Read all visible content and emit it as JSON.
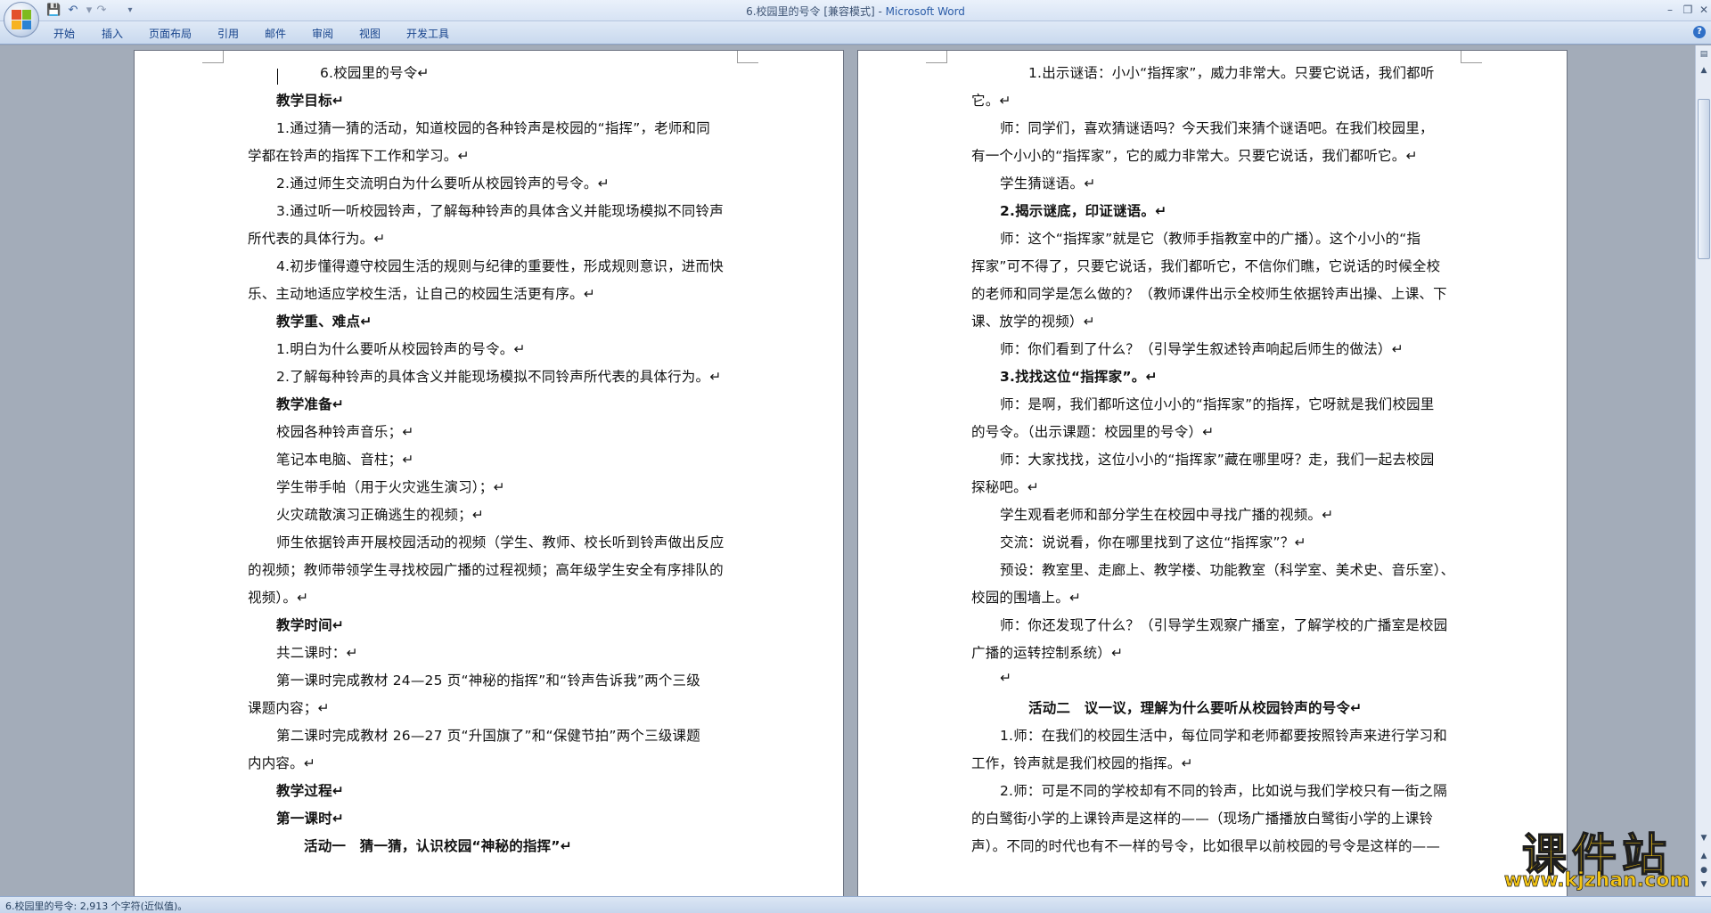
{
  "window": {
    "title": "6.校园里的号令 [兼容模式] - ",
    "app_name": "Microsoft Word"
  },
  "quick_access": {
    "save_icon": "save-icon",
    "undo_icon": "undo-icon",
    "redo_icon": "redo-icon"
  },
  "ribbon": {
    "tabs": [
      "开始",
      "插入",
      "页面布局",
      "引用",
      "邮件",
      "审阅",
      "视图",
      "开发工具"
    ]
  },
  "document": {
    "left_page": [
      {
        "text": "6.校园里的号令↵",
        "bold": false
      },
      {
        "text": "教学目标↵",
        "bold": true
      },
      {
        "text": "1.通过猜一猜的活动，知道校园的各种铃声是校园的“指挥”，老师和同",
        "bold": false
      },
      {
        "text": "学都在铃声的指挥下工作和学习。↵",
        "bold": false
      },
      {
        "text": "2.通过师生交流明白为什么要听从校园铃声的号令。↵",
        "bold": false
      },
      {
        "text": "3.通过听一听校园铃声，了解每种铃声的具体含义并能现场模拟不同铃声",
        "bold": false
      },
      {
        "text": "所代表的具体行为。↵",
        "bold": false
      },
      {
        "text": "4.初步懂得遵守校园生活的规则与纪律的重要性，形成规则意识，进而快",
        "bold": false
      },
      {
        "text": "乐、主动地适应学校生活，让自己的校园生活更有序。↵",
        "bold": false
      },
      {
        "text": "教学重、难点↵",
        "bold": true
      },
      {
        "text": "1.明白为什么要听从校园铃声的号令。↵",
        "bold": false
      },
      {
        "text": "2.了解每种铃声的具体含义并能现场模拟不同铃声所代表的具体行为。↵",
        "bold": false
      },
      {
        "text": "教学准备↵",
        "bold": true
      },
      {
        "text": "校园各种铃声音乐；↵",
        "bold": false
      },
      {
        "text": "笔记本电脑、音柱；↵",
        "bold": false
      },
      {
        "text": "学生带手帕（用于火灾逃生演习）；↵",
        "bold": false
      },
      {
        "text": "火灾疏散演习正确逃生的视频；↵",
        "bold": false
      },
      {
        "text": "师生依据铃声开展校园活动的视频（学生、教师、校长听到铃声做出反应",
        "bold": false
      },
      {
        "text": "的视频；教师带领学生寻找校园广播的过程视频；高年级学生安全有序排队的",
        "bold": false
      },
      {
        "text": "视频）。↵",
        "bold": false
      },
      {
        "text": "教学时间↵",
        "bold": true
      },
      {
        "text": "共二课时：↵",
        "bold": false
      },
      {
        "text": "第一课时完成教材 24—25 页“神秘的指挥”和“铃声告诉我”两个三级",
        "bold": false
      },
      {
        "text": "课题内容；↵",
        "bold": false
      },
      {
        "text": "第二课时完成教材 26—27 页“升国旗了”和“保健节拍”两个三级课题",
        "bold": false
      },
      {
        "text": "内内容。↵",
        "bold": false
      },
      {
        "text": "教学过程↵",
        "bold": true
      },
      {
        "text": "第一课时↵",
        "bold": true
      },
      {
        "text": "活动一　猜一猜，认识校园“神秘的指挥”↵",
        "bold": true
      }
    ],
    "right_page": [
      {
        "text": "1.出示谜语：小小“指挥家”，威力非常大。只要它说话，我们都听",
        "bold": false
      },
      {
        "text": "它。↵",
        "bold": false
      },
      {
        "text": "师：同学们，喜欢猜谜语吗？今天我们来猜个谜语吧。在我们校园里，",
        "bold": false
      },
      {
        "text": "有一个小小的“指挥家”，它的威力非常大。只要它说话，我们都听它。↵",
        "bold": false
      },
      {
        "text": "学生猜谜语。↵",
        "bold": false
      },
      {
        "text": "2.揭示谜底，印证谜语。↵",
        "bold": true
      },
      {
        "text": "师：这个“指挥家”就是它（教师手指教室中的广播）。这个小小的“指",
        "bold": false
      },
      {
        "text": "挥家”可不得了，只要它说话，我们都听它，不信你们瞧，它说话的时候全校",
        "bold": false
      },
      {
        "text": "的老师和同学是怎么做的？（教师课件出示全校师生依据铃声出操、上课、下",
        "bold": false
      },
      {
        "text": "课、放学的视频）↵",
        "bold": false
      },
      {
        "text": "师：你们看到了什么？（引导学生叙述铃声响起后师生的做法）↵",
        "bold": false
      },
      {
        "text": "3.找找这位“指挥家”。↵",
        "bold": true
      },
      {
        "text": "师：是啊，我们都听这位小小的“指挥家”的指挥，它呀就是我们校园里",
        "bold": false
      },
      {
        "text": "的号令。（出示课题：校园里的号令）↵",
        "bold": false
      },
      {
        "text": "师：大家找找，这位小小的“指挥家”藏在哪里呀？走，我们一起去校园",
        "bold": false
      },
      {
        "text": "探秘吧。↵",
        "bold": false
      },
      {
        "text": "学生观看老师和部分学生在校园中寻找广播的视频。↵",
        "bold": false
      },
      {
        "text": "交流：说说看，你在哪里找到了这位“指挥家”？↵",
        "bold": false
      },
      {
        "text": "预设：教室里、走廊上、教学楼、功能教室（科学室、美术史、音乐室）、",
        "bold": false
      },
      {
        "text": "校园的围墙上。↵",
        "bold": false
      },
      {
        "text": "师：你还发现了什么？（引导学生观察广播室，了解学校的广播室是校园",
        "bold": false
      },
      {
        "text": "广播的运转控制系统）↵",
        "bold": false
      },
      {
        "text": "↵",
        "bold": false
      },
      {
        "text": "活动二　议一议，理解为什么要听从校园铃声的号令↵",
        "bold": true
      },
      {
        "text": "1.师：在我们的校园生活中，每位同学和老师都要按照铃声来进行学习和",
        "bold": false
      },
      {
        "text": "工作，铃声就是我们校园的指挥。↵",
        "bold": false
      },
      {
        "text": "2.师：可是不同的学校却有不同的铃声，比如说与我们学校只有一街之隔",
        "bold": false
      },
      {
        "text": "的白鹭街小学的上课铃声是这样的——（现场广播播放白鹭街小学的上课铃",
        "bold": false
      },
      {
        "text": "声）。不同的时代也有不一样的号令，比如很早以前校园的号令是这样的——",
        "bold": false
      }
    ]
  },
  "statusbar": {
    "text": "6.校园里的号令: 2,913 个字符(近似值)。"
  },
  "watermark": {
    "title": "课件站",
    "url": "www.kjzhan.com"
  },
  "colors": {
    "ribbon_text": "#15428b",
    "title_app": "#2a5ca8",
    "watermark": "#f2c313"
  }
}
